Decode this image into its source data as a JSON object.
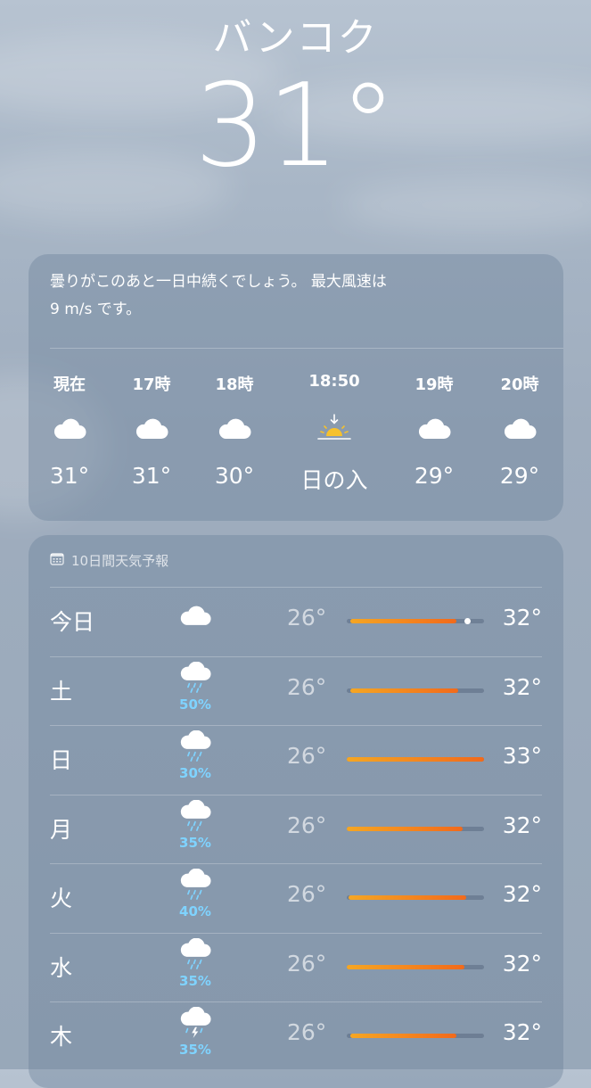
{
  "location": {
    "city": "バンコク",
    "temperature": "31°"
  },
  "summary": {
    "line1": "曇りがこのあと一日中続くでしょう。 最大風速は",
    "line2": "9 m/s です。"
  },
  "hourly": [
    {
      "label": "現在",
      "icon": "cloud-icon",
      "temp": "31°"
    },
    {
      "label": "17時",
      "icon": "cloud-icon",
      "temp": "31°"
    },
    {
      "label": "18時",
      "icon": "cloud-icon",
      "temp": "30°"
    },
    {
      "label": "18:50",
      "icon": "sunset-icon",
      "temp": "日の入"
    },
    {
      "label": "19時",
      "icon": "cloud-icon",
      "temp": "29°"
    },
    {
      "label": "20時",
      "icon": "cloud-icon",
      "temp": "29°"
    }
  ],
  "forecast": {
    "header": "10日間天気予報",
    "header_icon": "calendar-icon",
    "range_min": 26,
    "range_max": 33,
    "current_temp": 31,
    "days": [
      {
        "day": "今日",
        "icon": "cloud-icon",
        "pop": "",
        "low": "26°",
        "high": "32°",
        "bar_low": 26.2,
        "bar_high": 31.6
      },
      {
        "day": "土",
        "icon": "cloud-rain-icon",
        "pop": "50%",
        "low": "26°",
        "high": "32°",
        "bar_low": 26.2,
        "bar_high": 31.7
      },
      {
        "day": "日",
        "icon": "cloud-rain-icon",
        "pop": "30%",
        "low": "26°",
        "high": "33°",
        "bar_low": 26.0,
        "bar_high": 33.0
      },
      {
        "day": "月",
        "icon": "cloud-rain-icon",
        "pop": "35%",
        "low": "26°",
        "high": "32°",
        "bar_low": 26.0,
        "bar_high": 31.9
      },
      {
        "day": "火",
        "icon": "cloud-rain-icon",
        "pop": "40%",
        "low": "26°",
        "high": "32°",
        "bar_low": 26.1,
        "bar_high": 32.1
      },
      {
        "day": "水",
        "icon": "cloud-rain-icon",
        "pop": "35%",
        "low": "26°",
        "high": "32°",
        "bar_low": 25.8,
        "bar_high": 32.0
      },
      {
        "day": "木",
        "icon": "cloud-thunder-icon",
        "pop": "35%",
        "low": "26°",
        "high": "32°",
        "bar_low": 26.2,
        "bar_high": 31.6
      }
    ]
  },
  "colors": {
    "bar_start": "#f5a623",
    "bar_end": "#f26a1b",
    "precip_text": "#7fd3ff",
    "sun": "#f6c12c"
  }
}
